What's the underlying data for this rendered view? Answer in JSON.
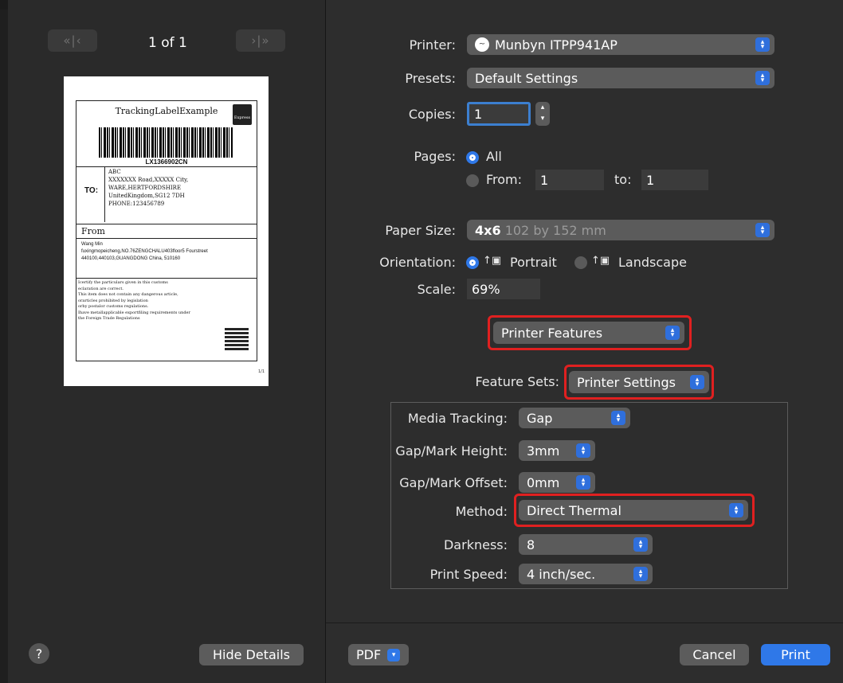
{
  "preview": {
    "page_indicator": "1 of 1",
    "first_btn": "«|‹",
    "next_btn": "›|»",
    "label": {
      "title": "TrackingLabelExample",
      "express": "Express",
      "barcode_number": "LX1366902CN",
      "to_heading": "TO:",
      "to_lines": [
        "ABC",
        "XXXXXXX Road,XXXXX City,",
        "WARE,HERTFORDSHIRE",
        "UnitedKingdom,SG12 7DH",
        "PHONE:123456789"
      ],
      "from_heading": "From",
      "from_lines": [
        "Wang Min",
        "fuxingmopeicheng,NO.76ZENGCHALU403floor5 Fourstreet",
        "440100,440103,GUANGDONG China, 510160"
      ],
      "cert_lines": [
        "Icertify the particulars given in this customs",
        "eclaration are correct.",
        "This item does not contain any dangerous article,",
        "orarticles prohibited by legislation",
        "orby postalor customs regulations.",
        "Ihave metallapplicable exportfiling requirements under",
        "the Foreign Trade Regulations"
      ],
      "page_num": "1/1"
    }
  },
  "footer_left": {
    "help": "?",
    "hide_details": "Hide Details"
  },
  "settings": {
    "printer_label": "Printer:",
    "printer_value": "Munbyn ITPP941AP",
    "presets_label": "Presets:",
    "presets_value": "Default Settings",
    "copies_label": "Copies:",
    "copies_value": "1",
    "pages_label": "Pages:",
    "pages_all": "All",
    "pages_from": "From:",
    "from_value": "1",
    "pages_to": "to:",
    "to_value": "1",
    "paper_label": "Paper Size:",
    "paper_value_bold": "4x6",
    "paper_value_dim": "102 by 152 mm",
    "orientation_label": "Orientation:",
    "portrait": "Portrait",
    "landscape": "Landscape",
    "scale_label": "Scale:",
    "scale_value": "69%",
    "section_popup": "Printer Features",
    "feature_sets_label": "Feature Sets:",
    "feature_sets_value": "Printer Settings"
  },
  "features": {
    "media_tracking_label": "Media Tracking:",
    "media_tracking_value": "Gap",
    "gap_height_label": "Gap/Mark Height:",
    "gap_height_value": "3mm",
    "gap_offset_label": "Gap/Mark Offset:",
    "gap_offset_value": "0mm",
    "method_label": "Method:",
    "method_value": "Direct Thermal",
    "darkness_label": "Darkness:",
    "darkness_value": "8",
    "speed_label": "Print Speed:",
    "speed_value": "4 inch/sec."
  },
  "footer_right": {
    "pdf": "PDF",
    "cancel": "Cancel",
    "print": "Print"
  },
  "colors": {
    "accent": "#2f78e8",
    "highlight": "#e02020"
  }
}
